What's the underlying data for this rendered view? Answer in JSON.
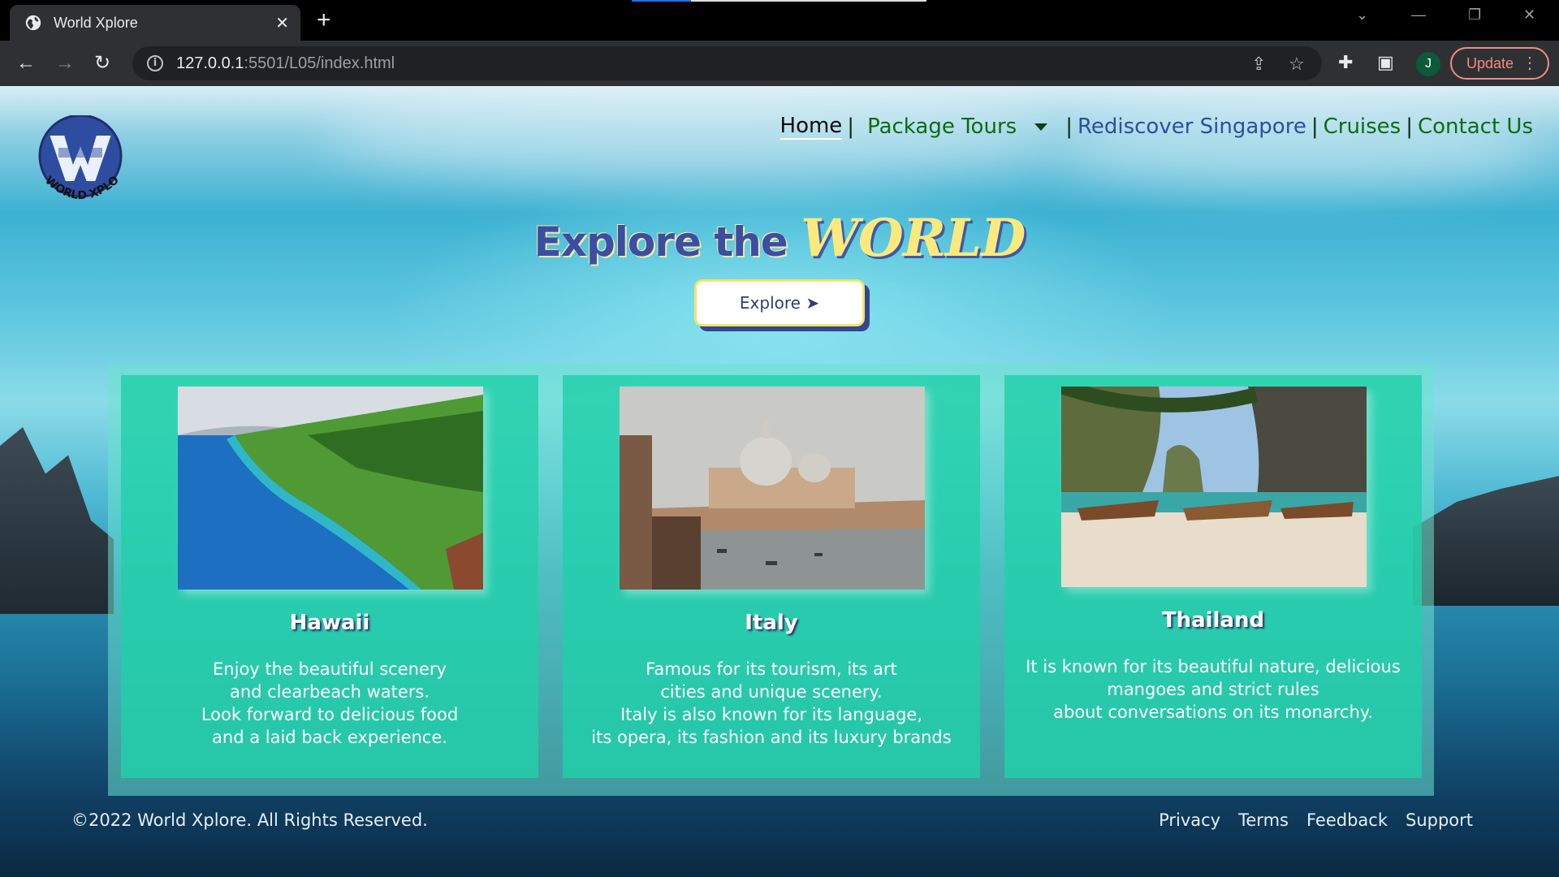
{
  "browser": {
    "tab_title": "World Xplore",
    "url_host": "127.0.0.1",
    "url_path": ":5501/L05/index.html",
    "profile_initial": "J",
    "update_label": "Update"
  },
  "nav": {
    "home": "Home",
    "package_tours": "Package Tours",
    "rediscover": "Rediscover Singapore",
    "cruises": "Cruises",
    "contact": "Contact Us",
    "separator": "|"
  },
  "logo": {
    "text": "WORLD XPLORE"
  },
  "hero": {
    "title_prefix": "Explore the ",
    "title_emphasis": "WORLD",
    "button_label": "Explore ➤"
  },
  "cards": [
    {
      "title": "Hawaii",
      "lines": [
        "Enjoy the beautiful scenery",
        "and clearbeach waters.",
        "Look forward to delicious food",
        "and a laid back experience."
      ]
    },
    {
      "title": "Italy",
      "lines": [
        "Famous for its tourism, its art",
        "cities and unique scenery.",
        "Italy is also known for its language,",
        "its opera, its fashion and its luxury brands"
      ]
    },
    {
      "title": "Thailand",
      "lines": [
        "It is known for its beautiful nature, delicious",
        "mangoes and strict rules",
        "about conversations on its monarchy."
      ]
    }
  ],
  "footer": {
    "copyright": "©2022 World Xplore. All Rights Reserved.",
    "links": [
      "Privacy",
      "Terms",
      "Feedback",
      "Support"
    ]
  },
  "colors": {
    "nav_green": "#0e6b14",
    "nav_blue": "#2d4f9e",
    "card_bg": "#21d0aa",
    "title_blue": "#3b4ea4",
    "title_yellow": "#fbe97e"
  }
}
